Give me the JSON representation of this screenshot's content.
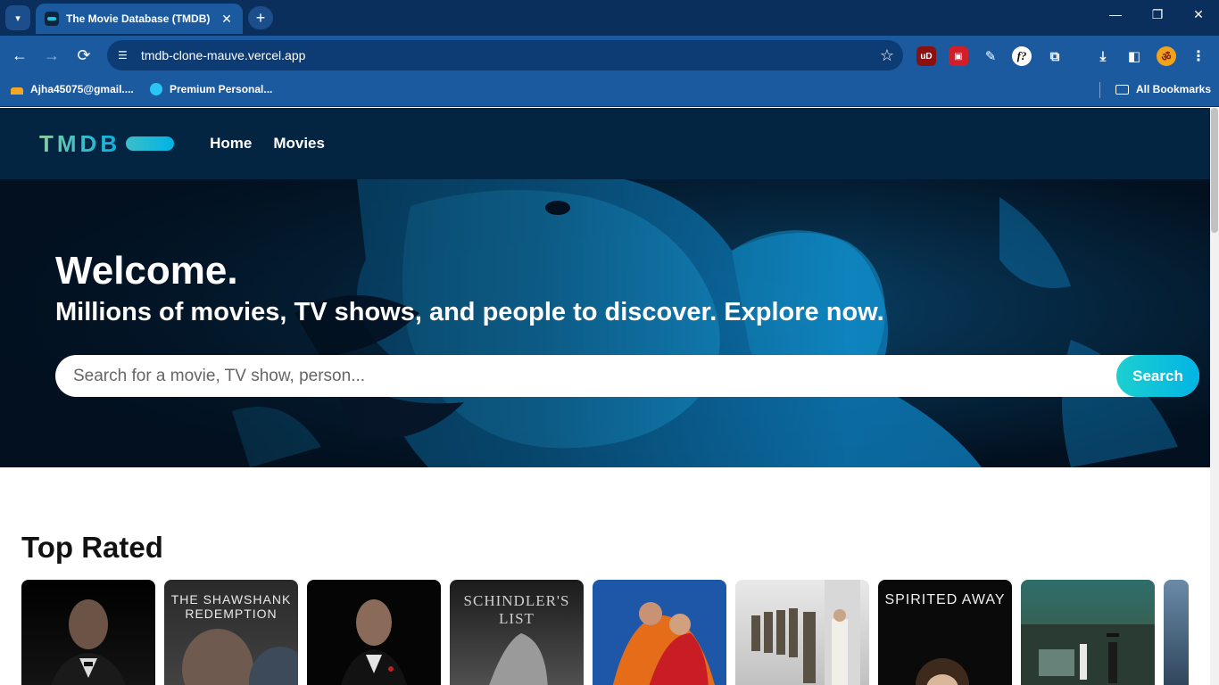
{
  "browser": {
    "tab_title": "The Movie Database (TMDB)",
    "tab_close": "✕",
    "new_tab": "+",
    "url": "tmdb-clone-mauve.vercel.app",
    "bookmarks": [
      {
        "label": "Ajha45075@gmail...."
      },
      {
        "label": "Premium Personal..."
      }
    ],
    "all_bookmarks": "All Bookmarks",
    "extensions": [
      "uD",
      "f?"
    ]
  },
  "site": {
    "logo": "TMDB",
    "nav": {
      "home": "Home",
      "movies": "Movies"
    }
  },
  "hero": {
    "title": "Welcome.",
    "subtitle": "Millions of movies, TV shows, and people to discover. Explore now.",
    "search_placeholder": "Search for a movie, TV show, person...",
    "search_button": "Search",
    "accent_color": "#01b4e4"
  },
  "top_rated": {
    "title": "Top Rated",
    "posters": [
      {
        "label": ""
      },
      {
        "label": "THE SHAWSHANK REDEMPTION"
      },
      {
        "label": ""
      },
      {
        "label": "SCHINDLER'S LIST"
      },
      {
        "label": ""
      },
      {
        "label": ""
      },
      {
        "label": "SPIRITED AWAY"
      },
      {
        "label": ""
      },
      {
        "label": ""
      }
    ]
  }
}
